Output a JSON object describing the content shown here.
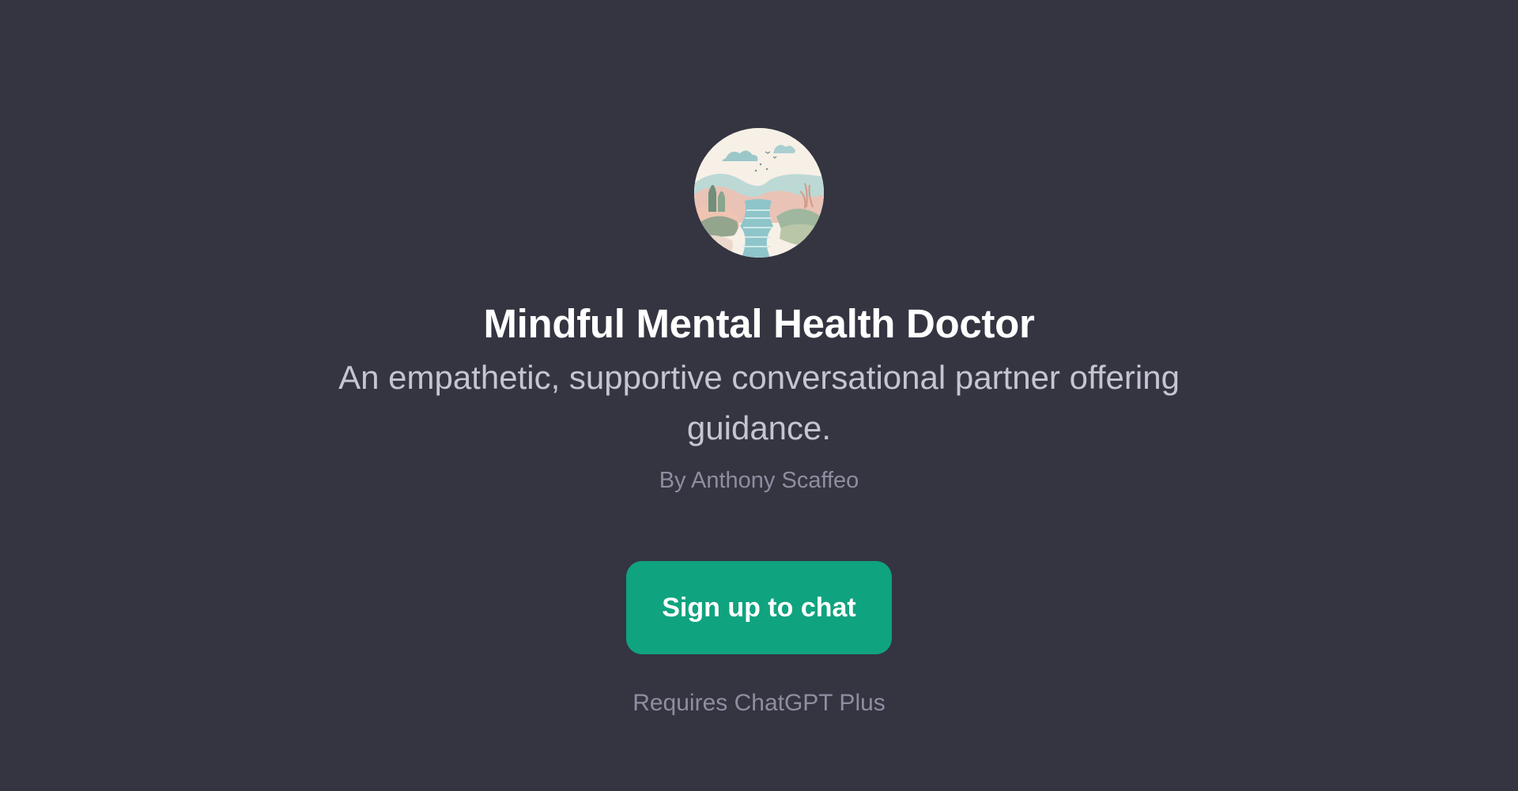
{
  "gpt": {
    "title": "Mindful Mental Health Doctor",
    "description": "An empathetic, supportive conversational partner offering guidance.",
    "author": "By Anthony Scaffeo"
  },
  "actions": {
    "signup_label": "Sign up to chat",
    "requirement": "Requires ChatGPT Plus"
  },
  "avatar": {
    "icon": "landscape-illustration"
  },
  "colors": {
    "background": "#343541",
    "button": "#10a37f",
    "title": "#ffffff",
    "subtitle": "#c5c5d2",
    "muted": "#8e8ea0"
  }
}
